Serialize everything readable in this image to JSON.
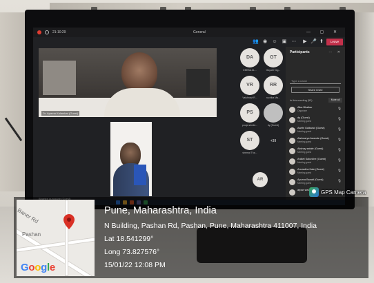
{
  "window": {
    "timer": "21:10:29",
    "title": "General",
    "leave_label": "Leave"
  },
  "main_video": {
    "name_label": "Dr. Aparna Kalamkar (Guest)"
  },
  "second_video": {
    "name_label": "Bhartee gurugane (Guest)"
  },
  "tiles": [
    {
      "initials": "DA",
      "name": "DEEBA AL..."
    },
    {
      "initials": "GT",
      "name": "Gayatri Tag..."
    },
    {
      "initials": "VR",
      "name": "Vaishnavi R..."
    },
    {
      "initials": "RR",
      "name": "ruchika Ma..."
    },
    {
      "initials": "PS",
      "name": "pooja shedd..."
    },
    {
      "initials": "",
      "name": "dy (Guest)"
    },
    {
      "initials": "ST",
      "name": "shemal Tha..."
    },
    {
      "initials": "",
      "name": "+39"
    },
    {
      "initials": "AR",
      "name": ""
    }
  ],
  "panel": {
    "title": "Participants",
    "search_placeholder": "Type a name",
    "share_label": "Share invite",
    "in_meeting_label": "In this meeting (52)",
    "mute_all_label": "Mute all",
    "participants": [
      {
        "name": "Alka Bhatkar",
        "role": "Organizer"
      },
      {
        "name": "dy (Guest)",
        "role": "Meeting guest"
      },
      {
        "name": "Aarthi Gaikwad (Guest)",
        "role": "Meeting guest"
      },
      {
        "name": "Aishwarya Awande (Guest)",
        "role": "Meeting guest"
      },
      {
        "name": "Akshay satale (Guest)",
        "role": "Meeting guest"
      },
      {
        "name": "Aniket Salunkhe (Guest)",
        "role": "Meeting guest"
      },
      {
        "name": "Anuradha Kale (Guest)",
        "role": "Meeting guest"
      },
      {
        "name": "Apurva Banait (Guest)",
        "role": "Meeting guest"
      },
      {
        "name": "arpan wal...",
        "role": ""
      }
    ]
  },
  "taskbar": {
    "search_placeholder": "Type here to search"
  },
  "gps": {
    "badge": "GPS Map Camera",
    "map_labels": {
      "road1": "Baner Rd",
      "area": "Pashan"
    },
    "google_logo": "Google",
    "location_title": "Pune, Maharashtra, India",
    "address": "N Building, Pashan Rd, Pashan, Pune, Maharashtra 411007, India",
    "lat": "Lat 18.541299°",
    "long": "Long 73.827576°",
    "datetime": "15/01/22 12:08 PM"
  },
  "colors": {
    "leave_red": "#c4314b",
    "panel_bg": "#292929",
    "pin_red": "#d93025"
  }
}
